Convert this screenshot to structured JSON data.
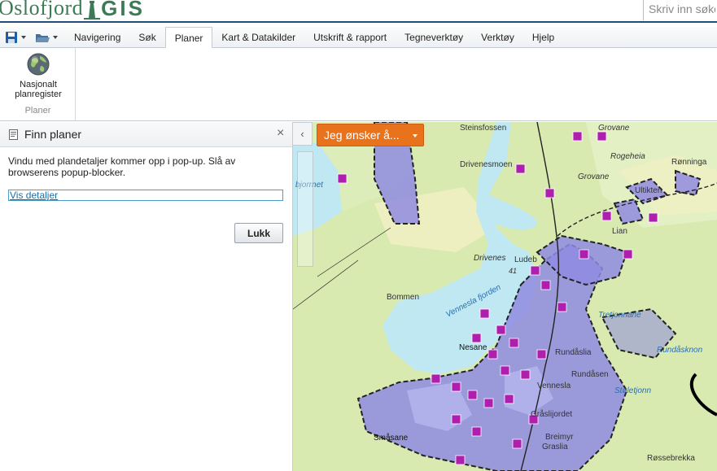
{
  "header": {
    "logo_part1": "Oslofjord",
    "logo_part2": "GIS",
    "search_placeholder": "Skriv inn søke"
  },
  "menu": {
    "tabs": [
      {
        "label": "Navigering"
      },
      {
        "label": "Søk"
      },
      {
        "label": "Planer",
        "active": true
      },
      {
        "label": "Kart & Datakilder"
      },
      {
        "label": "Utskrift & rapport"
      },
      {
        "label": "Tegneverktøy"
      },
      {
        "label": "Verktøy"
      },
      {
        "label": "Hjelp"
      }
    ]
  },
  "ribbon": {
    "button_label": "Nasjonalt\nplanregister",
    "group_label": "Planer"
  },
  "panel": {
    "title": "Finn planer",
    "message": "Vindu med plandetaljer kommer opp i pop-up. Slå av browserens popup-blocker.",
    "details_link": "Vis detaljer",
    "close_button": "Lukk"
  },
  "map": {
    "action_button": "Jeg ønsker å...",
    "labels": [
      "Steinsfossen",
      "Drivenesmoen",
      "Rogeheia",
      "Grovane",
      "Grovane",
      "Rønninga",
      "Ultikten",
      "Lian",
      "Drivenes",
      "41",
      "Ludeb",
      "Bommen",
      "Vennesla fjorden",
      "Tretjonnane",
      "Nesane",
      "Rundåslia",
      "Rundåsen",
      "Rundåsknon",
      "Vennesla",
      "Støletjonn",
      "Gråslijordet",
      "Breimyr",
      "Graslia",
      "Småsane",
      "Røssebrekka",
      "bjorrnet"
    ]
  },
  "colors": {
    "brand_green": "#3d7a56",
    "accent_orange": "#e8731c",
    "plan_purple": "#8f8be0",
    "water": "#bfe8f2",
    "forest": "#d8eab0",
    "link_blue": "#1a6ea8"
  },
  "icons": {
    "save": "floppy-disk-icon",
    "open": "folder-icon",
    "ribbon": "globe-icon",
    "panel": "document-icon",
    "close": "close-icon"
  }
}
